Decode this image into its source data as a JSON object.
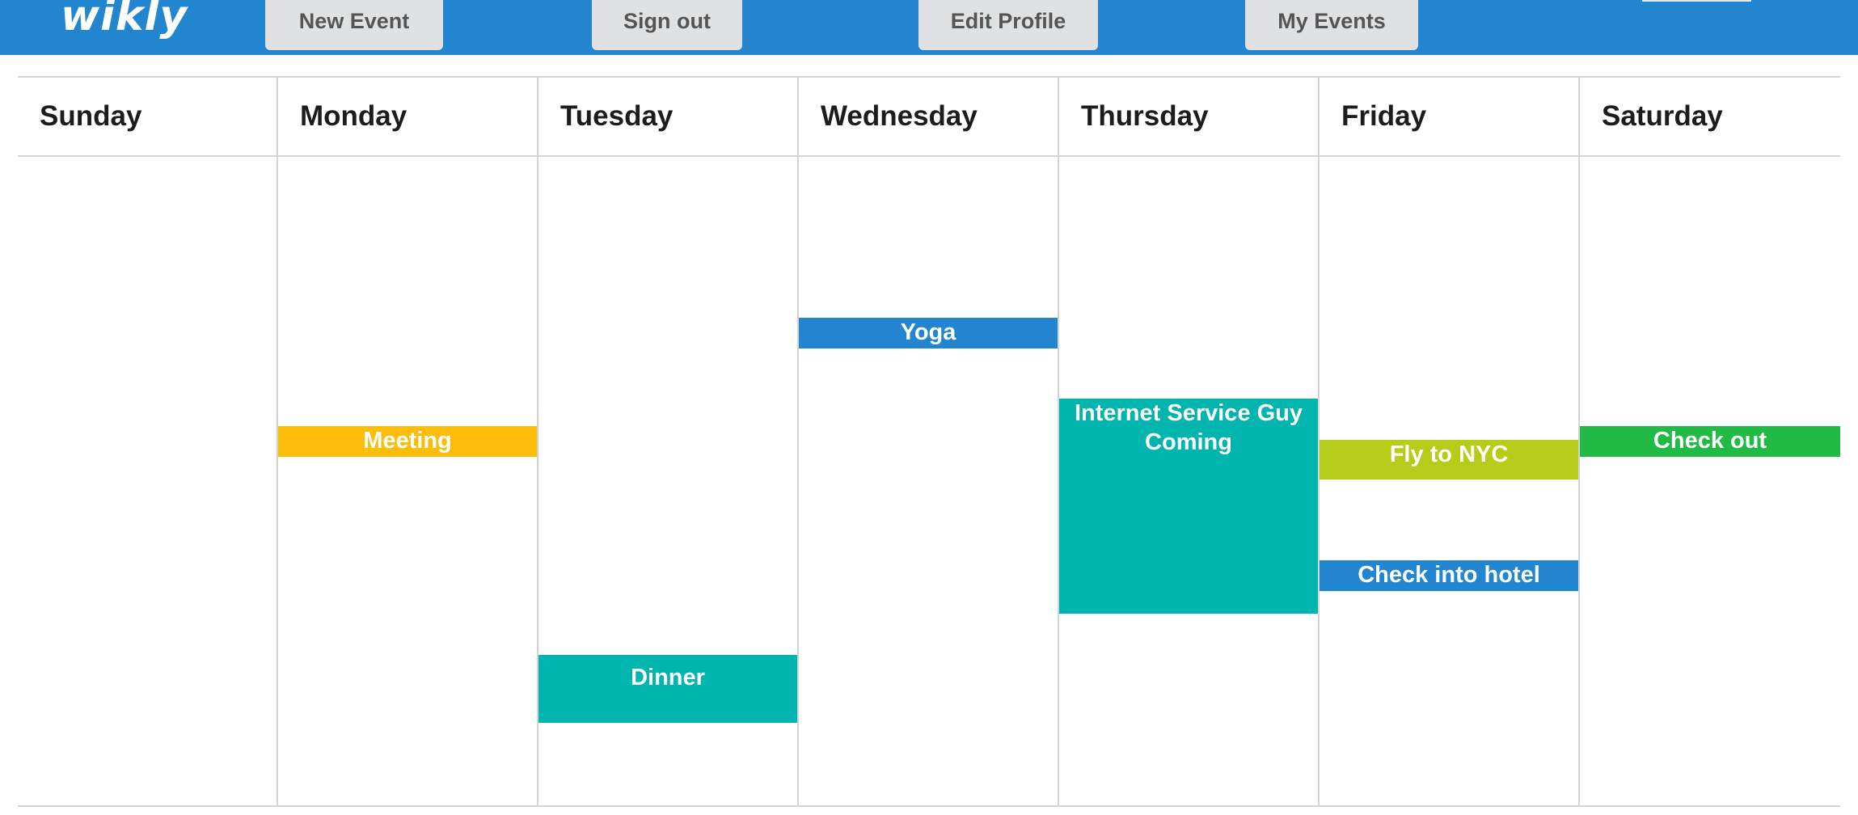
{
  "app": {
    "logo": "wikly"
  },
  "nav": {
    "new_event": "New Event",
    "sign_out": "Sign out",
    "edit_profile": "Edit Profile",
    "my_events": "My Events"
  },
  "calendar": {
    "days": [
      "Sunday",
      "Monday",
      "Tuesday",
      "Wednesday",
      "Thursday",
      "Friday",
      "Saturday"
    ],
    "events": [
      {
        "day": "Monday",
        "title": "Meeting",
        "color": "#fbbd08"
      },
      {
        "day": "Tuesday",
        "title": "Dinner",
        "color": "#00b5ad"
      },
      {
        "day": "Wednesday",
        "title": "Yoga",
        "color": "#2185d0"
      },
      {
        "day": "Thursday",
        "title": "Internet Service Guy Coming",
        "color": "#00b5ad"
      },
      {
        "day": "Friday",
        "title": "Fly to NYC",
        "color": "#b5cc18"
      },
      {
        "day": "Friday",
        "title": "Check into hotel",
        "color": "#2185d0"
      },
      {
        "day": "Saturday",
        "title": "Check out",
        "color": "#21ba45"
      }
    ]
  },
  "colors": {
    "topbar": "#2185d0",
    "button_bg": "#e0e1e2",
    "grid_line": "#d4d4d5"
  }
}
